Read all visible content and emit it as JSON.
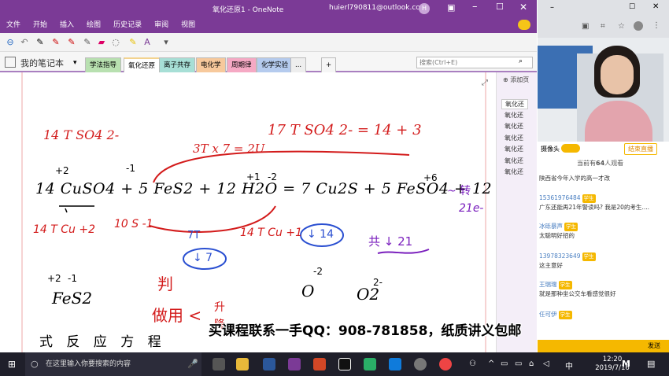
{
  "onenote": {
    "window_title": "氧化还原1  -  OneNote",
    "account": "huierl790811@outlook.com",
    "account_initial": "H",
    "menu": [
      "文件",
      "开始",
      "插入",
      "绘图",
      "历史记录",
      "审阅",
      "视图"
    ],
    "notebook": "我的笔记本",
    "tabs": [
      {
        "label": "学法指导",
        "color": "#b8e0b0"
      },
      {
        "label": "氧化还原",
        "color": "#f3d38f"
      },
      {
        "label": "离子共存",
        "color": "#a7dfd6"
      },
      {
        "label": "电化学",
        "color": "#f7c99c"
      },
      {
        "label": "周期律",
        "color": "#f5a9c4"
      },
      {
        "label": "化学实验",
        "color": "#b5cbee"
      },
      {
        "label": "...",
        "color": "#eeeeee"
      },
      {
        "label": "+",
        "color": "#f6f6f6"
      }
    ],
    "search_placeholder": "搜索(Ctrl+E)",
    "add_page": "添加页",
    "pages": [
      "氧化还",
      "氧化还",
      "氧化还",
      "氧化还",
      "氧化还",
      "氧化还",
      "氧化还"
    ],
    "handwriting": {
      "line1_left": "14 T SO4 2-",
      "line1_right": "17 T SO4 2-  =  14 + 3",
      "arrow_note": "3T x 7 = 2U",
      "equation": "14 CuSO4 + 5 FeS2 + 12 H2O = 7 Cu2S + 5 FeSO4 + 12 H2SO4",
      "charges_top": [
        "+2",
        "-1",
        "+1",
        "-2",
        "+6"
      ],
      "right_notes": [
        "~ 转",
        "21e-"
      ],
      "below_left": "14 T Cu +2",
      "below_mid": "10 S -1",
      "below_mid2": "14 T Cu +1",
      "box1": "↓ 7",
      "box2": "↓ 14",
      "box_note": "7T",
      "s_note": "共 ↓ 21",
      "lower_left": "FeS2",
      "lower_charges": [
        "+2",
        "-1",
        "-2",
        "2-"
      ],
      "lower_items": [
        "O",
        "O2"
      ],
      "red_notes": [
        "判",
        "做用 <",
        "升",
        "降"
      ],
      "bottom_cut": "式 反 应 方 程"
    }
  },
  "stream": {
    "browser_tab_icons": [
      "back",
      "forward",
      "reload"
    ],
    "camera_label": "摄像头",
    "end_live": "结束直播",
    "viewers_prefix": "当前有",
    "viewers_count": "64",
    "viewers_suffix": "人观看",
    "chat": [
      {
        "name": "",
        "text": "陕西省今年入学的高一才改",
        "badge": ""
      },
      {
        "name": "15361976484",
        "text": "广东还能再21年警读吗? 我是20的考生....",
        "badge": "学生"
      },
      {
        "name": "冰砾暴声",
        "text": "太聪明好招的",
        "badge": "学生"
      },
      {
        "name": "13978323649",
        "text": "这主意好",
        "badge": "学生"
      },
      {
        "name": "王瑞瑞",
        "text": "就是那种坐公交车看感觉很好",
        "badge": "学生"
      },
      {
        "name": "任可伊",
        "text": "",
        "badge": "学生"
      }
    ],
    "send_label": "发送"
  },
  "taskbar": {
    "search_placeholder": "在这里输入你要搜索的内容",
    "time": "12:20",
    "date": "2019/7/16",
    "ime": "中"
  },
  "watermark": "买课程联系一手QQ：908-781858，纸质讲义包邮"
}
